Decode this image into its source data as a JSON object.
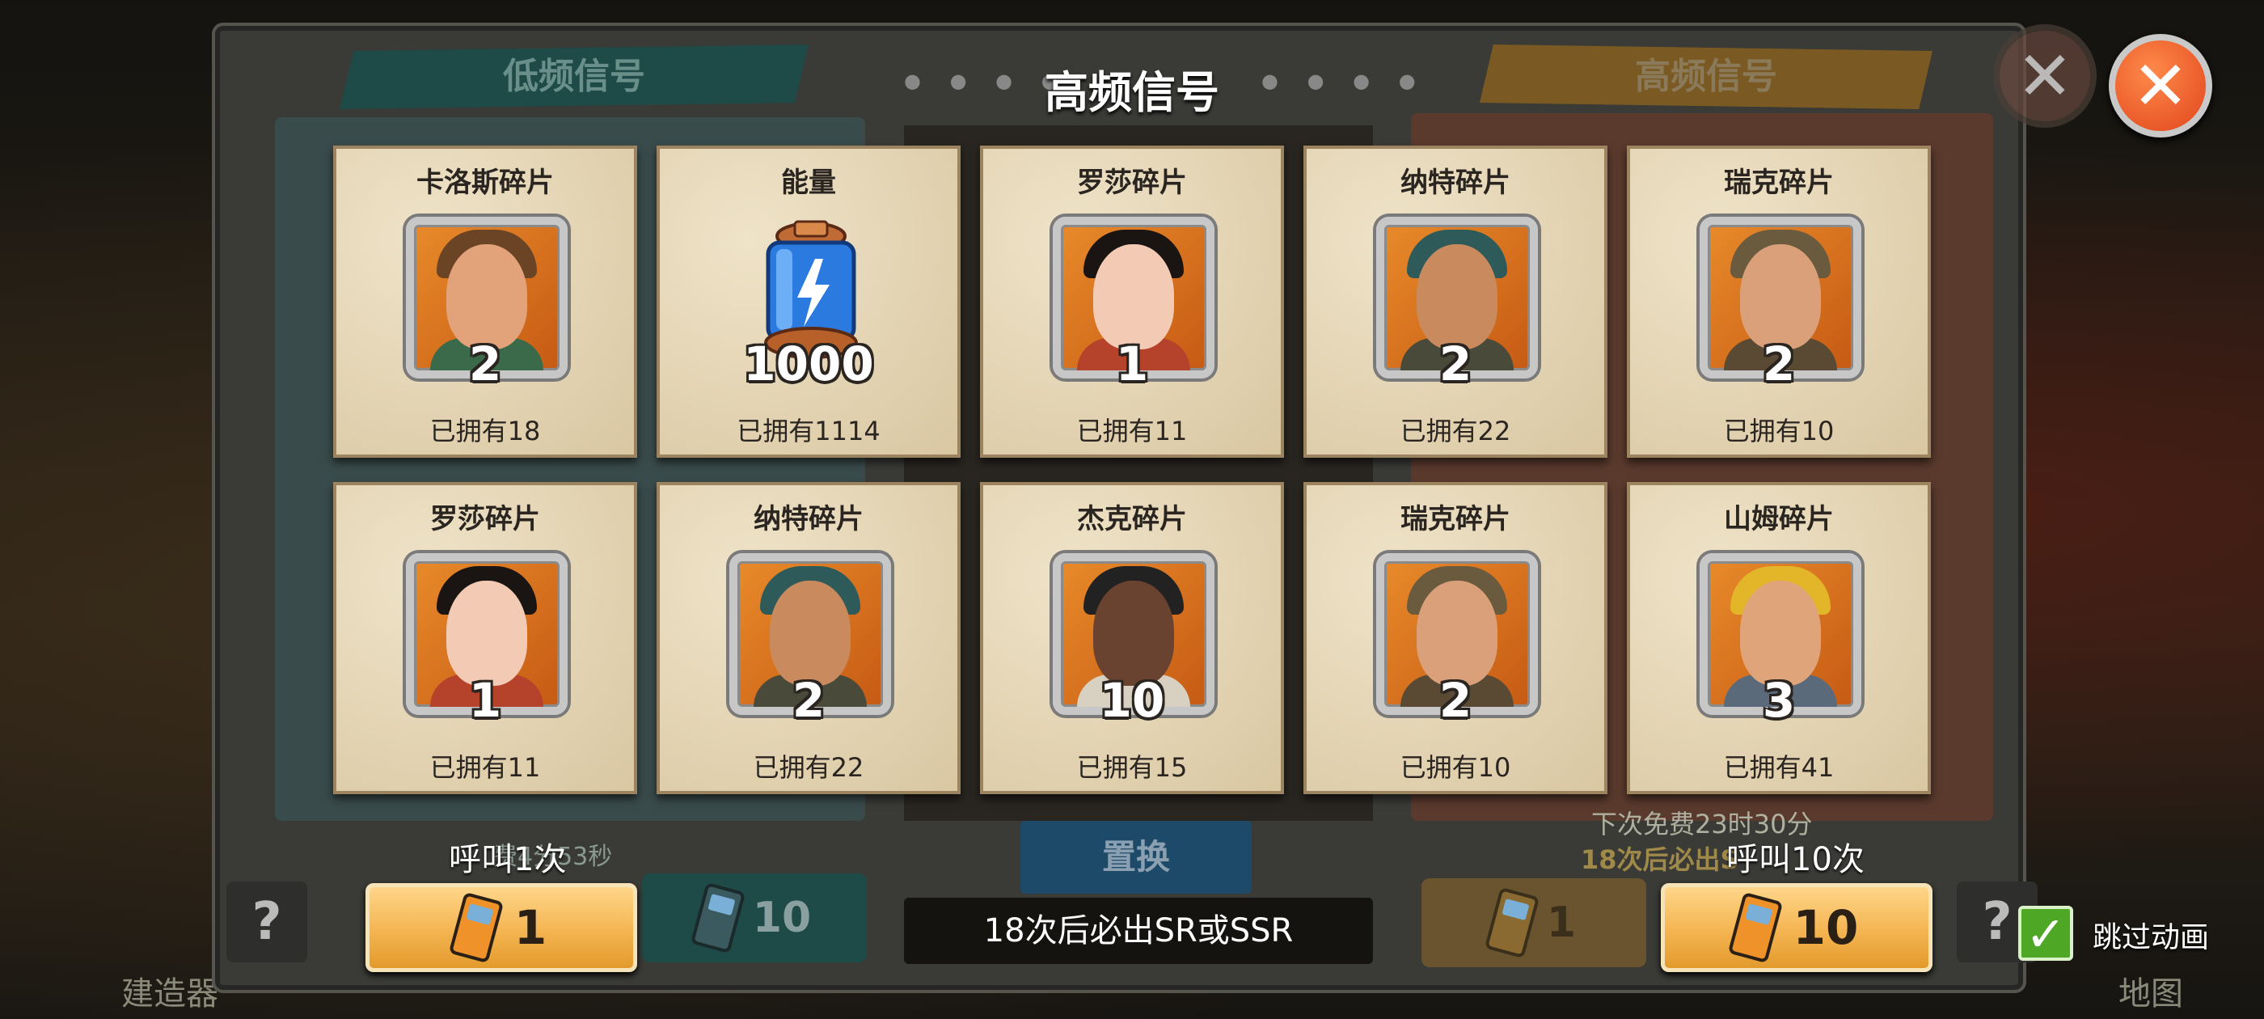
{
  "title": "高频信号",
  "banners": {
    "left": "低频信号",
    "right": "高频信号"
  },
  "cards": [
    {
      "name": "卡洛斯碎片",
      "qty": "2",
      "owned": "已拥有18",
      "portrait": "carlos",
      "skin": "#e2a27a",
      "hair": "#6b4426",
      "shirt": "#3a6a4a"
    },
    {
      "name": "能量",
      "qty": "1000",
      "owned": "已拥有1114",
      "portrait": "energy-battery"
    },
    {
      "name": "罗莎碎片",
      "qty": "1",
      "owned": "已拥有11",
      "portrait": "rosa",
      "skin": "#f3cbb5",
      "hair": "#1a1412",
      "shirt": "#b5422a"
    },
    {
      "name": "纳特碎片",
      "qty": "2",
      "owned": "已拥有22",
      "portrait": "nate",
      "skin": "#c98a5e",
      "hair": "#2f5a5a",
      "shirt": "#4a4a3a"
    },
    {
      "name": "瑞克碎片",
      "qty": "2",
      "owned": "已拥有10",
      "portrait": "rick",
      "skin": "#d9a07a",
      "hair": "#6a5a3e",
      "shirt": "#5a4a34"
    },
    {
      "name": "罗莎碎片",
      "qty": "1",
      "owned": "已拥有11",
      "portrait": "rosa",
      "skin": "#f3cbb5",
      "hair": "#1a1412",
      "shirt": "#b5422a"
    },
    {
      "name": "纳特碎片",
      "qty": "2",
      "owned": "已拥有22",
      "portrait": "nate",
      "skin": "#c98a5e",
      "hair": "#2f5a5a",
      "shirt": "#4a4a3a"
    },
    {
      "name": "杰克碎片",
      "qty": "10",
      "owned": "已拥有15",
      "portrait": "jack",
      "skin": "#6a4330",
      "hair": "#222222",
      "shirt": "#d8d0c0"
    },
    {
      "name": "瑞克碎片",
      "qty": "2",
      "owned": "已拥有10",
      "portrait": "rick",
      "skin": "#d9a07a",
      "hair": "#6a5a3e",
      "shirt": "#5a4a34"
    },
    {
      "name": "山姆碎片",
      "qty": "3",
      "owned": "已拥有41",
      "portrait": "sam",
      "skin": "#e0a47a",
      "hair": "#e3b62a",
      "shirt": "#5a6a7a"
    }
  ],
  "call_once": {
    "label": "呼叫1次",
    "cost": "1"
  },
  "call_ten": {
    "label": "呼叫10次",
    "cost": "10"
  },
  "status": "18次后必出SR或SSR",
  "replace": "置换",
  "dim_left": {
    "cost": "10",
    "timer": "费4分53秒"
  },
  "dim_right": {
    "cost": "1",
    "free_next": "下次免费23时30分",
    "guarantee": "18次后必出S"
  },
  "skip_animation": {
    "label": "跳过动画",
    "checked": true,
    "check": "✓"
  },
  "close_icon": "✕",
  "help": "?",
  "background_labels": {
    "build": "建造器",
    "map": "地图"
  },
  "colors": {
    "gold": "#f4b451",
    "panel_teal": "#1e4a47",
    "panel_orange": "#7a5a22",
    "check_green": "#4ea826"
  }
}
